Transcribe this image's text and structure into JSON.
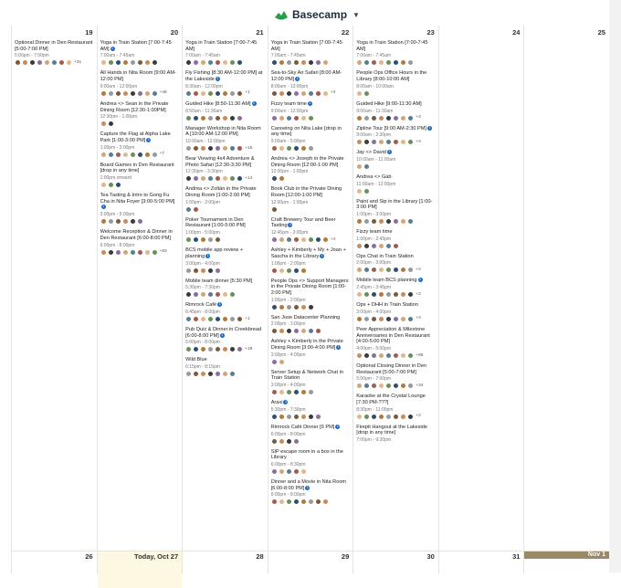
{
  "brand": {
    "name": "Basecamp",
    "logo_icon": "basecamp-mountain-icon",
    "accent": "#27a048"
  },
  "colors": {
    "badge": "#1b6ac9",
    "today_bg": "#fdf8e2",
    "nov_bar": "#9a8866"
  },
  "week1": {
    "days": [
      "19",
      "20",
      "21",
      "22",
      "23",
      "24",
      "25"
    ],
    "columns": [
      {
        "events": [
          {
            "title": "Optional Dinner in Den Restaurant [5:00-7:00 PM]",
            "time": "5:00pm - 7:00pm",
            "av": 8,
            "more": "+31"
          }
        ]
      },
      {
        "events": [
          {
            "title": "Yoga in Train Station [7:00-7:45 AM]",
            "time": "7:00am - 7:45am",
            "av": 8,
            "more": "",
            "badge": "1"
          },
          {
            "title": "All Hands in Nita Room [9:00 AM-12:00 PM]",
            "time": "9:00am - 12:00pm",
            "av": 8,
            "more": "+48"
          },
          {
            "title": "Andrea <> Sean in the Private Dining Room [12:30-1:00PM]",
            "time": "12:30pm - 1:00pm",
            "av": 2,
            "more": ""
          },
          {
            "title": "Capture the Flag at Alpha Lake Park [1:00-3:00 PM]",
            "time": "1:00pm - 3:00pm",
            "av": 8,
            "more": "+7",
            "badge": "1"
          },
          {
            "title": "Board Games in Den Restaurant [drop in any time]",
            "time": "1:00pm onward",
            "av": 3,
            "more": ""
          },
          {
            "title": "Tea Tasting & Intro to Gong Fu Cha in Nita Foyer [3:00-5:00 PM]",
            "time": "3:00pm - 5:00pm",
            "av": 6,
            "more": "",
            "badge": "1"
          },
          {
            "title": "Welcome Reception & Dinner in Den Restaurant [6:00-8:00 PM]",
            "time": "6:00pm - 8:00pm",
            "av": 8,
            "more": "+83"
          }
        ]
      },
      {
        "events": [
          {
            "title": "Yoga in Train Station [7:00-7:45 AM]",
            "time": "7:00am - 7:45am",
            "av": 8,
            "more": ""
          },
          {
            "title": "Fly Fishing [8:30 AM-12:00 PM] at the Lakeside",
            "time": "8:30am - 12:00pm",
            "av": 8,
            "more": "+1",
            "badge": "1"
          },
          {
            "title": "Guided Hike [8:50-11:30 AM]",
            "time": "8:50am - 11:30am",
            "av": 8,
            "more": "",
            "badge": "1"
          },
          {
            "title": "Manager Workshop in Nita Room A [10:00 AM-12:00 PM]",
            "time": "10:00am - 12:00pm",
            "av": 8,
            "more": "+15"
          },
          {
            "title": "Bear Viewing 4x4 Adventure & Photo Safari [12:30-3:30 PM]",
            "time": "12:30pm - 3:30pm",
            "av": 8,
            "more": "+14"
          },
          {
            "title": "Andrea <> Zoltán in the Private Dining Room [1:00-2:00 PM]",
            "time": "1:00pm - 2:00pm",
            "av": 2,
            "more": ""
          },
          {
            "title": "Poker Tournament in Den Restaurant [1:00-5:00 PM]",
            "time": "1:00pm - 5:00pm",
            "av": 5,
            "more": ""
          },
          {
            "title": "BCS mobile app review + planning",
            "time": "3:00pm - 4:00pm",
            "av": 5,
            "more": "",
            "badge": "1"
          },
          {
            "title": "Mobile team dinner [5:30 PM]",
            "time": "5:30pm - 7:30pm",
            "av": 7,
            "more": ""
          },
          {
            "title": "Rimrock Café",
            "time": "6:45pm - 8:00pm",
            "av": 8,
            "more": "+1",
            "badge": "1"
          },
          {
            "title": "Pub Quiz & Dinner in Creekbread [6:00-8:00 PM]",
            "time": "6:00pm - 8:00pm",
            "av": 8,
            "more": "+19",
            "badge": "1"
          },
          {
            "title": "Wild Blue",
            "time": "6:15pm - 8:15pm",
            "av": 7,
            "more": ""
          }
        ]
      },
      {
        "events": [
          {
            "title": "Yoga in Train Station [7:00-7:45 AM]",
            "time": "7:00am - 7:45am",
            "av": 8,
            "more": ""
          },
          {
            "title": "Sea-to-Sky Air Safari [8:00 AM-12:00 PM]",
            "time": "8:00am - 12:00pm",
            "av": 8,
            "more": "+3",
            "badge": "1"
          },
          {
            "title": "Fizzy team time",
            "time": "9:00am - 12:00pm",
            "av": 6,
            "more": "",
            "badge": "1"
          },
          {
            "title": "Canoeing on Nita Lake [drop in any time]",
            "time": "9:00am - 5:00pm",
            "av": 6,
            "more": ""
          },
          {
            "title": "Andrea <> Joseph in the Private Dining Room [12:00-1:00 PM]",
            "time": "12:00pm - 1:00pm",
            "av": 2,
            "more": ""
          },
          {
            "title": "Book Club in the Private Dining Room [12:00-1:00 PM]",
            "time": "12:00pm - 1:00pm",
            "av": 1,
            "more": ""
          },
          {
            "title": "Craft Brewery Tour and Beer Tasting",
            "time": "12:45pm - 3:00pm",
            "av": 8,
            "more": "+4",
            "badge": "1"
          },
          {
            "title": "Ashley + Kimberly + My + Joan + Sascha in the Library",
            "time": "1:00pm - 2:00pm",
            "av": 5,
            "more": "",
            "badge": "1"
          },
          {
            "title": "People Ops <> Support Managers in the Private Dining Room [1:00-2:00 PM]",
            "time": "1:00pm - 2:00pm",
            "av": 6,
            "more": ""
          },
          {
            "title": "San Jose Datacenter Planning",
            "time": "2:00pm - 3:00pm",
            "av": 7,
            "more": ""
          },
          {
            "title": "Ashley + Kimberly in the Private Dining Room [3:00-4:00 PM]",
            "time": "3:00pm - 4:00pm",
            "av": 2,
            "more": "",
            "badge": "1"
          },
          {
            "title": "Server Setup & Network Chat in Train Station",
            "time": "3:00pm - 4:00pm",
            "av": 6,
            "more": ""
          },
          {
            "title": "Araxi",
            "time": "5:30pm - 7:30pm",
            "av": 7,
            "more": "",
            "badge": "1"
          },
          {
            "title": "Rimrock Café Dinner [6 PM]",
            "time": "6:00pm - 8:00pm",
            "av": 4,
            "more": "",
            "badge": "1"
          },
          {
            "title": "SIP escape room in a box in the Library",
            "time": "6:00pm - 8:30pm",
            "av": 5,
            "more": ""
          },
          {
            "title": "Dinner and a Movie in Nita Room [6:00-8:00 PM]",
            "time": "6:00pm - 8:00pm",
            "av": 8,
            "more": "",
            "badge": "1"
          }
        ]
      },
      {
        "events": [
          {
            "title": "Yoga in Train Station [7:00-7:45 AM]",
            "time": "7:00am - 7:45am",
            "av": 8,
            "more": ""
          },
          {
            "title": "People Ops Office Hours in the Library [8:00-10:00 AM]",
            "time": "8:00am - 10:00am",
            "av": 2,
            "more": ""
          },
          {
            "title": "Guided Hike [9:00-11:30 AM]",
            "time": "9:00am - 11:30am",
            "av": 8,
            "more": "+3"
          },
          {
            "title": "Zipline Tour [9:00 AM-2:30 PM]",
            "time": "9:00am - 2:30pm",
            "av": 8,
            "more": "+4",
            "badge": "1"
          },
          {
            "title": "Jay <> David",
            "time": "10:00am - 11:00am",
            "av": 2,
            "more": "",
            "badge": "1"
          },
          {
            "title": "Andrea <> Gab",
            "time": "11:00am - 12:00pm",
            "av": 2,
            "more": ""
          },
          {
            "title": "Paint and Sip in the Library [1:00-3:00 PM]",
            "time": "1:00pm - 3:00pm",
            "av": 8,
            "more": ""
          },
          {
            "title": "Fizzy team time",
            "time": "1:00pm - 2:45pm",
            "av": 6,
            "more": ""
          },
          {
            "title": "Ops Chat in Train Station",
            "time": "2:00pm - 3:00pm",
            "av": 8,
            "more": "+2"
          },
          {
            "title": "Mobile team BCS planning",
            "time": "2:45pm - 3:45pm",
            "av": 8,
            "more": "+2",
            "badge": "1"
          },
          {
            "title": "Ops + DHH in Train Station",
            "time": "3:00pm - 4:00pm",
            "av": 8,
            "more": "+4"
          },
          {
            "title": "Peer Appreciation & Milestone Anniversaries in Den Restaurant [4:00-5:00 PM]",
            "time": "4:00pm - 5:00pm",
            "av": 8,
            "more": "+85"
          },
          {
            "title": "Optional Closing Dinner in Den Restaurant [5:00-7:00 PM]",
            "time": "5:00pm - 7:00pm",
            "av": 8,
            "more": "+34"
          },
          {
            "title": "Karaoke at the Crystal Lounge [7:30 PM-???]",
            "time": "8:30pm - 11:00pm",
            "av": 8,
            "more": "+2"
          },
          {
            "title": "Firepit Hangout at the Lakeside [drop in any time]",
            "time": "7:00pm - 9:30pm",
            "av": 0,
            "more": ""
          }
        ]
      },
      {
        "events": []
      },
      {
        "events": []
      }
    ]
  },
  "week2": {
    "days": [
      "26",
      "Today, Oct 27",
      "28",
      "29",
      "30",
      "31",
      "Nov 1"
    ]
  }
}
